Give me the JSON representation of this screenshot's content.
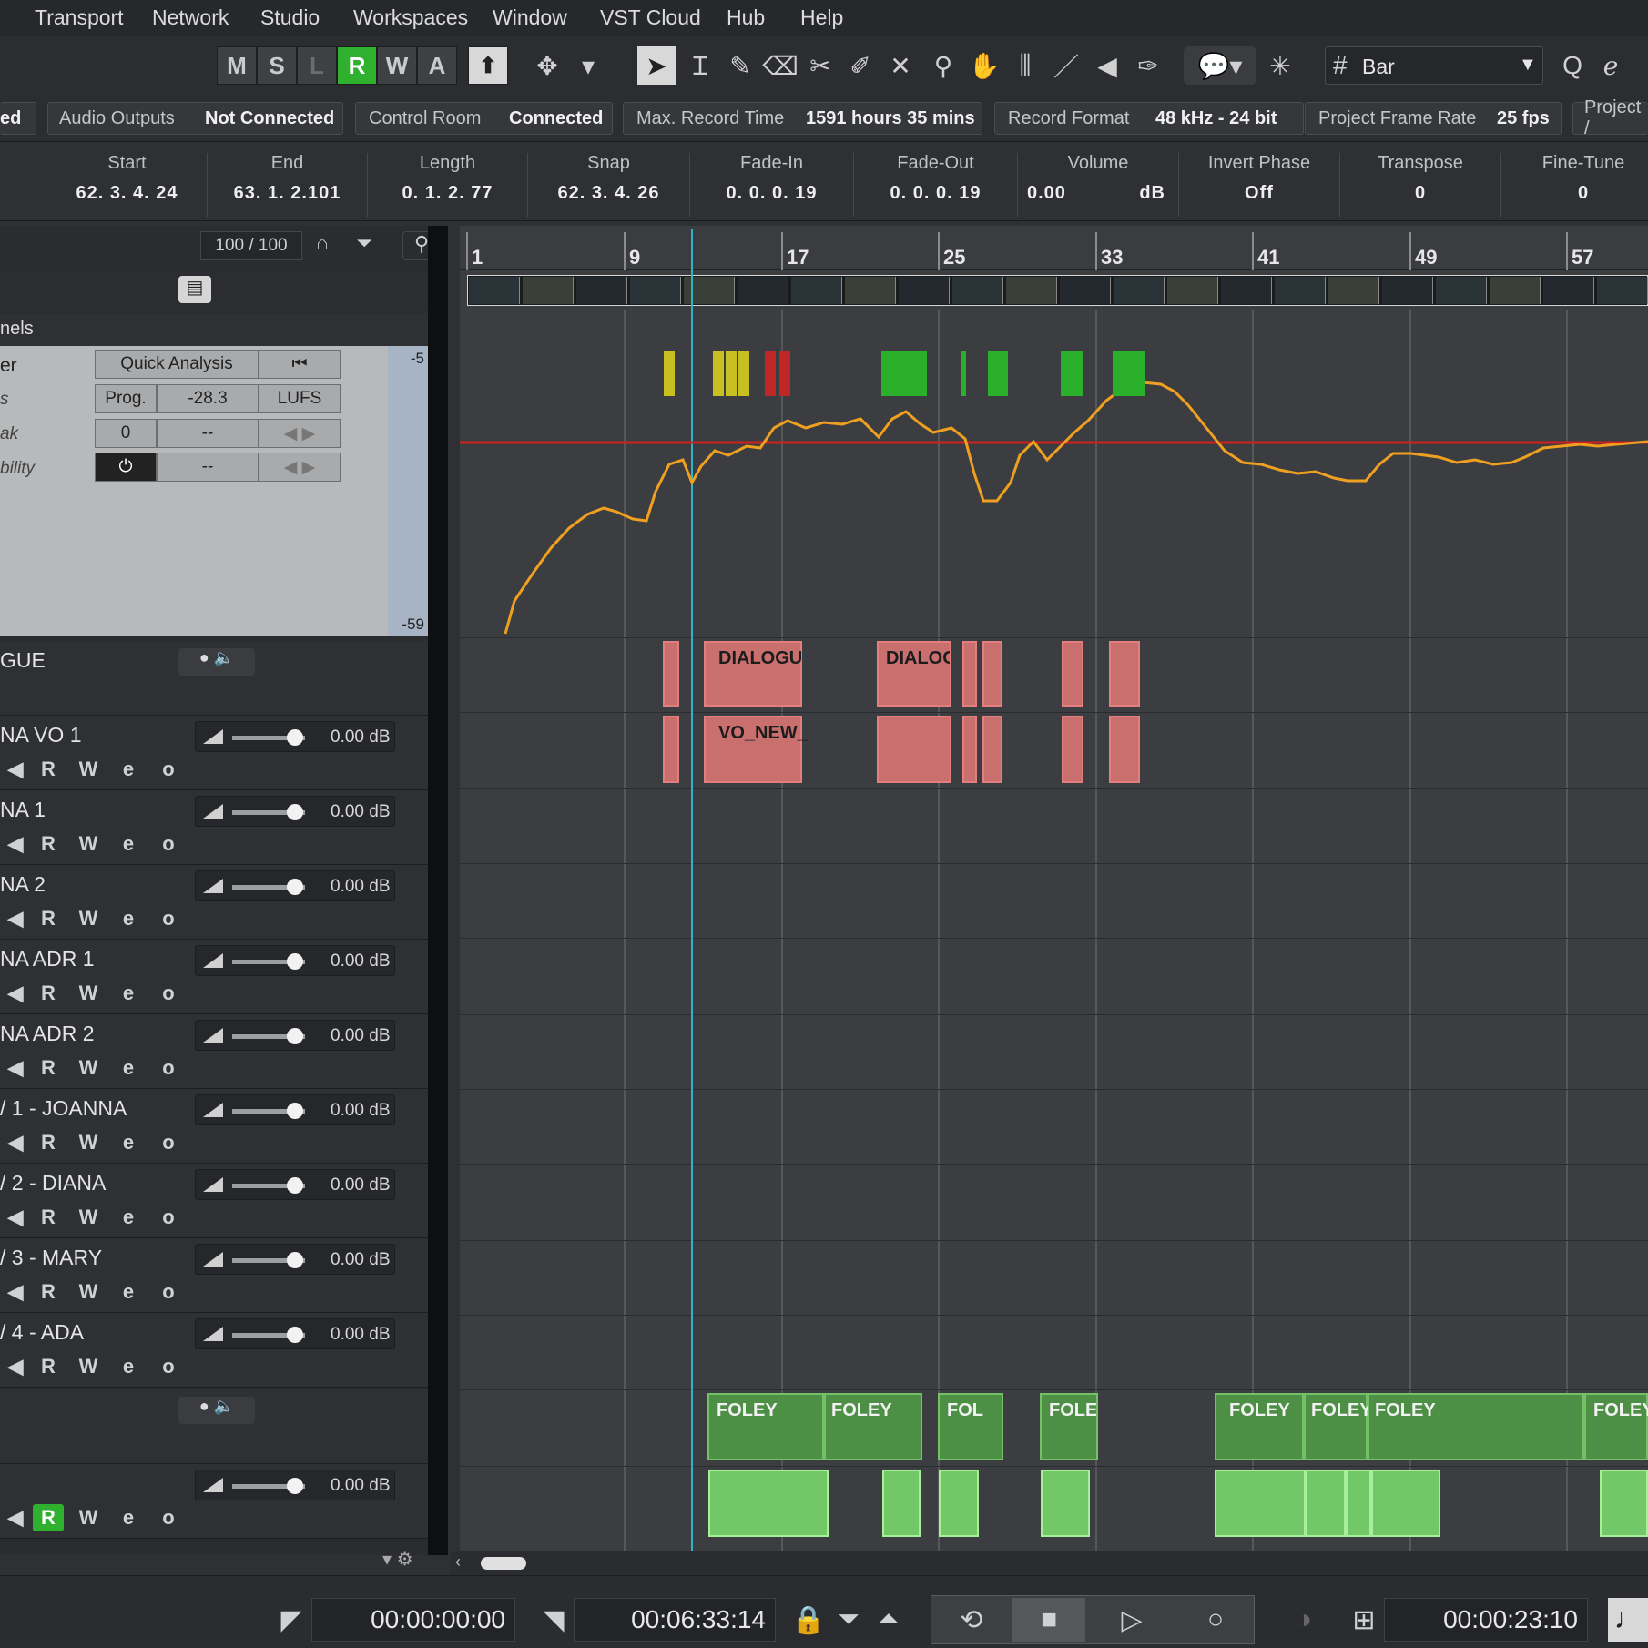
{
  "menu": [
    "Transport",
    "Network",
    "Studio",
    "Workspaces",
    "Window",
    "VST Cloud",
    "Hub",
    "Help"
  ],
  "toolbar": {
    "buttons": [
      "M",
      "S",
      "L",
      "R",
      "W",
      "A"
    ],
    "snap_type": "Bar"
  },
  "status": {
    "cut_prefix": "ed",
    "audio_outputs_label": "Audio Outputs",
    "audio_outputs_value": "Not Connected",
    "control_room_label": "Control Room",
    "control_room_value": "Connected",
    "max_record_label": "Max. Record Time",
    "max_record_value": "1591 hours 35 mins",
    "record_format_label": "Record Format",
    "record_format_value": "48 kHz - 24 bit",
    "frame_rate_label": "Project Frame Rate",
    "frame_rate_value": "25 fps",
    "project_cut": "Project /"
  },
  "info": {
    "start_label": "Start",
    "start": "62. 3. 4. 24",
    "end_label": "End",
    "end": "63. 1. 2.101",
    "length_label": "Length",
    "length": "0. 1. 2. 77",
    "snap_label": "Snap",
    "snap": "62. 3. 4. 26",
    "fadein_label": "Fade-In",
    "fadein": "0. 0. 0. 19",
    "fadeout_label": "Fade-Out",
    "fadeout": "0. 0. 0. 19",
    "volume_label": "Volume",
    "volume": "0.00",
    "volume_unit": "dB",
    "invert_label": "Invert Phase",
    "invert": "Off",
    "transpose_label": "Transpose",
    "transpose": "0",
    "finetune_label": "Fine-Tune",
    "finetune": "0"
  },
  "tracklist": {
    "count": "100 / 100",
    "section_label": "nels",
    "loudness": {
      "row1_label": "er",
      "quick_analysis": "Quick Analysis",
      "row2_label": "s",
      "prog": "Prog.",
      "prog_value": "-28.3",
      "unit": "LUFS",
      "row3_label": "ak",
      "peak_value": "0",
      "peak_dash": "--",
      "row4_label": "bility",
      "bility_dash": "--",
      "scale_top": "-5",
      "scale_bottom": "-59"
    },
    "tracks": [
      {
        "name": "GUE",
        "db": ""
      },
      {
        "name": "NA VO 1",
        "db": "0.00 dB"
      },
      {
        "name": "NA 1",
        "db": "0.00 dB"
      },
      {
        "name": "NA 2",
        "db": "0.00 dB"
      },
      {
        "name": "NA ADR 1",
        "db": "0.00 dB"
      },
      {
        "name": "NA ADR 2",
        "db": "0.00 dB"
      },
      {
        "name": "/ 1 - JOANNA",
        "db": "0.00 dB"
      },
      {
        "name": "/ 2 - DIANA",
        "db": "0.00 dB"
      },
      {
        "name": "/ 3 - MARY",
        "db": "0.00 dB"
      },
      {
        "name": "/ 4 - ADA",
        "db": "0.00 dB"
      },
      {
        "name": "",
        "db": ""
      },
      {
        "name": "",
        "db": "0.00 dB"
      }
    ],
    "automation_buttons": [
      "R",
      "W",
      "e",
      "o"
    ]
  },
  "ruler": [
    "1",
    "9",
    "17",
    "25",
    "33",
    "41",
    "49",
    "57"
  ],
  "events": {
    "dialogue1": "DIALOGU",
    "dialogue2": "DIALOG",
    "vo": "VO_NEW_",
    "foley": [
      "FOLEY",
      "FOLEY",
      "FOL",
      "FOLE",
      "FOLEY",
      "FOLEY",
      "FOLEY",
      "FOLEY"
    ]
  },
  "transport": {
    "left_locator": "00:00:00:00",
    "right_locator": "00:06:33:14",
    "position": "00:00:23:10"
  },
  "colors": {
    "accent_green": "#2fb12f",
    "loudness_curve": "#f0a020",
    "target_line": "#d02020",
    "cursor": "#2ab6c8",
    "dialogue_event": "#c9706f",
    "foley_event": "#4d8f44"
  }
}
